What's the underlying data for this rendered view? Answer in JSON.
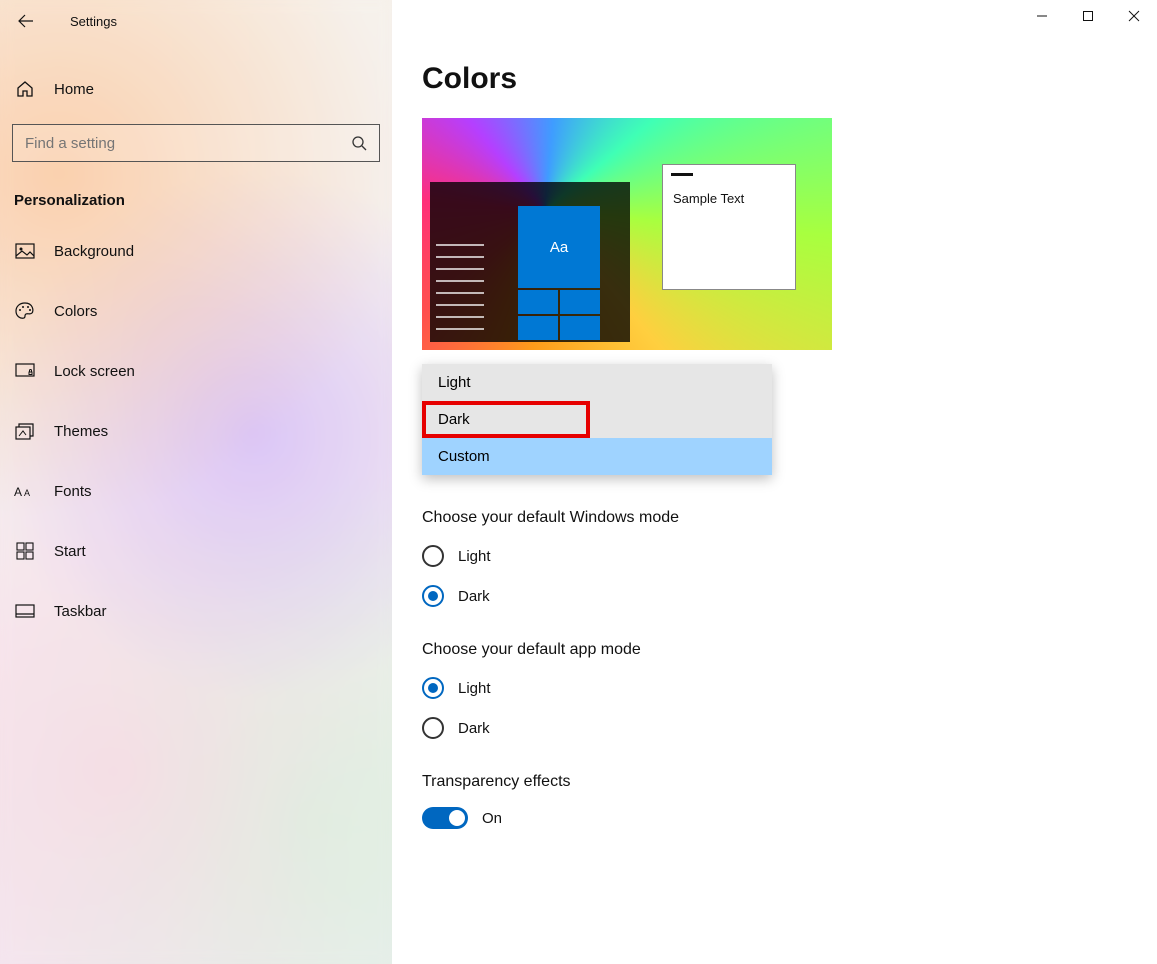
{
  "window": {
    "title": "Settings"
  },
  "sidebar": {
    "home": "Home",
    "search_placeholder": "Find a setting",
    "section": "Personalization",
    "items": [
      {
        "label": "Background"
      },
      {
        "label": "Colors"
      },
      {
        "label": "Lock screen"
      },
      {
        "label": "Themes"
      },
      {
        "label": "Fonts"
      },
      {
        "label": "Start"
      },
      {
        "label": "Taskbar"
      }
    ]
  },
  "page": {
    "title": "Colors",
    "preview": {
      "tile_text": "Aa",
      "sample_text": "Sample Text"
    },
    "dropdown": {
      "options": [
        {
          "label": "Light"
        },
        {
          "label": "Dark"
        },
        {
          "label": "Custom"
        }
      ],
      "highlighted_index": 1,
      "selected_index": 2
    },
    "windows_mode": {
      "heading": "Choose your default Windows mode",
      "options": [
        {
          "label": "Light"
        },
        {
          "label": "Dark"
        }
      ],
      "selected": "Dark"
    },
    "app_mode": {
      "heading": "Choose your default app mode",
      "options": [
        {
          "label": "Light"
        },
        {
          "label": "Dark"
        }
      ],
      "selected": "Light"
    },
    "transparency": {
      "heading": "Transparency effects",
      "state_label": "On",
      "on": true
    }
  }
}
